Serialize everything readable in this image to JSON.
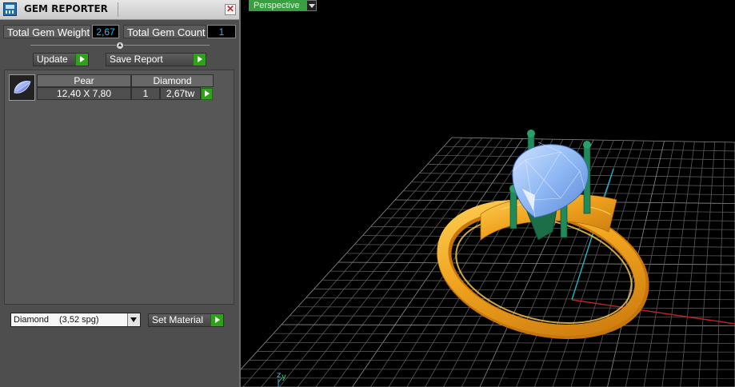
{
  "panel": {
    "title": "GEM REPORTER",
    "close_glyph": "✕",
    "total_weight_label": "Total Gem Weight",
    "total_weight_value": "2,67",
    "total_count_label": "Total Gem Count",
    "total_count_value": "1",
    "update_label": "Update",
    "save_report_label": "Save Report",
    "table": {
      "headers": [
        "Pear",
        "Diamond"
      ],
      "size": "12,40 X 7,80",
      "count": "1",
      "weight": "2,67tw"
    },
    "material_select": {
      "name": "Diamond",
      "density": "(3,52 spg)"
    },
    "set_material_label": "Set Material"
  },
  "viewport": {
    "view_name": "Perspective",
    "axis_z": "z",
    "axis_y": "y"
  },
  "colors": {
    "panel_bg": "#4e4e4e",
    "value_text": "#2fb4ff",
    "accent_green": "#2ea31a",
    "view_tab": "#39a042",
    "metal_gold": "#f0a41e",
    "prong_green": "#1f8a5a",
    "gem_blue": "#8fb8f4"
  },
  "icons": {
    "app": "gem-reporter-app-icon",
    "close": "close-icon",
    "go": "play-arrow-icon",
    "dropdown": "chevron-down-icon",
    "gem": "pear-gem-icon"
  }
}
